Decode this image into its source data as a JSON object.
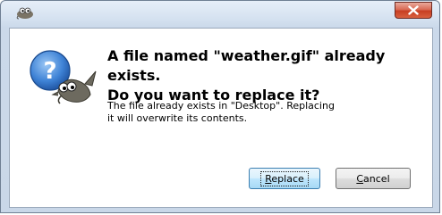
{
  "titlebar": {
    "title": "",
    "close_symbol": "x"
  },
  "dialog": {
    "icon": "question-with-gimp-mascot",
    "primary_text": "A file named \"weather.gif\" already exists.\nDo you want to replace it?",
    "secondary_text": "The file already exists in \"Desktop\".  Replacing\nit will overwrite its contents."
  },
  "buttons": {
    "replace": {
      "mnemonic": "R",
      "rest": "eplace",
      "default": true
    },
    "cancel": {
      "mnemonic": "C",
      "rest": "ancel"
    }
  },
  "colors": {
    "titlebar": "#d7e3f1",
    "close_button": "#c73e22",
    "question_icon": "#2f6fc0",
    "default_button": "#3c7fb1"
  }
}
